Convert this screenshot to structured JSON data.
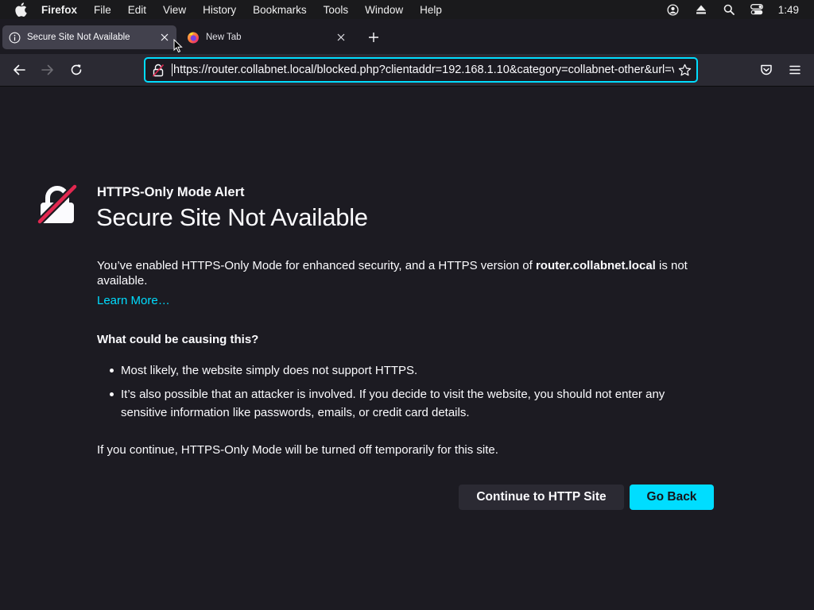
{
  "menubar": {
    "app_name": "Firefox",
    "items": [
      "File",
      "Edit",
      "View",
      "History",
      "Bookmarks",
      "Tools",
      "Window",
      "Help"
    ],
    "clock": "1:49"
  },
  "tabs": [
    {
      "title": "Secure Site Not Available",
      "icon": "info-icon",
      "active": true
    },
    {
      "title": "New Tab",
      "icon": "firefox-logo-icon",
      "active": false
    }
  ],
  "urlbar": {
    "url": "https://router.collabnet.local/blocked.php?clientaddr=192.168.1.10&category=collabnet-other&url=vi"
  },
  "alert": {
    "eyebrow": "HTTPS-Only Mode Alert",
    "title": "Secure Site Not Available",
    "intro_before": "You’ve enabled HTTPS-Only Mode for enhanced security, and a HTTPS version of ",
    "intro_host": "router.collabnet.local",
    "intro_after": " is not available.",
    "learn_more": "Learn More…",
    "causes_title": "What could be causing this?",
    "causes": [
      "Most likely, the website simply does not support HTTPS.",
      "It’s also possible that an attacker is involved. If you decide to visit the website, you should not enter any sensitive information like passwords, emails, or credit card details."
    ],
    "continue_note": "If you continue, HTTPS-Only Mode will be turned off temporarily for this site.",
    "continue_button": "Continue to HTTP Site",
    "back_button": "Go Back"
  },
  "colors": {
    "accent": "#00ddff",
    "page_background": "#1c1b22",
    "toolbar_background": "#2b2a33",
    "icon_slash": "#e22850"
  }
}
